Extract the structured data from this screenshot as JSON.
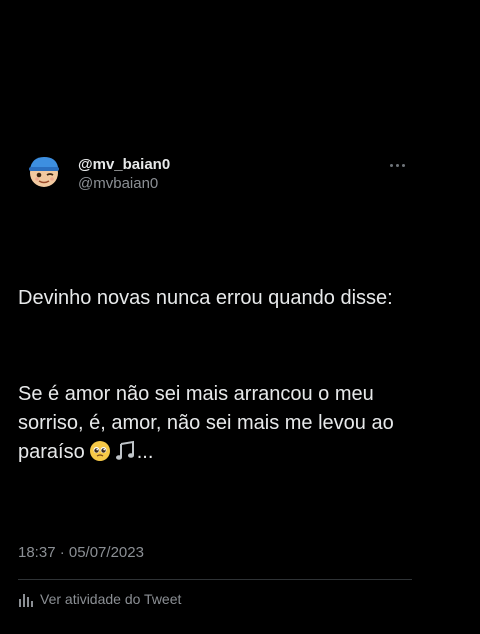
{
  "tweet": {
    "display_name": "@mv_baian0",
    "handle": "@mvbaian0",
    "paragraph_1": "Devinho novas nunca errou quando disse:",
    "paragraph_2": "Se é amor não sei mais arrancou o meu sorriso, é, amor, não sei mais me levou ao paraíso",
    "paragraph_2_tail": "...",
    "timestamp": "18:37 · 05/07/2023",
    "activity_label": "Ver atividade do Tweet"
  },
  "icons": {
    "avatar": "memoji-avatar-blue-cap",
    "more": "more-horizontal-icon",
    "emoji_1": "pleading-face-emoji",
    "emoji_2": "musical-notes-emoji",
    "activity": "analytics-bars-icon"
  },
  "colors": {
    "background": "#000000",
    "primary_text": "#e7e9ea",
    "secondary_text": "#8b8f94",
    "divider": "#2f3336"
  }
}
